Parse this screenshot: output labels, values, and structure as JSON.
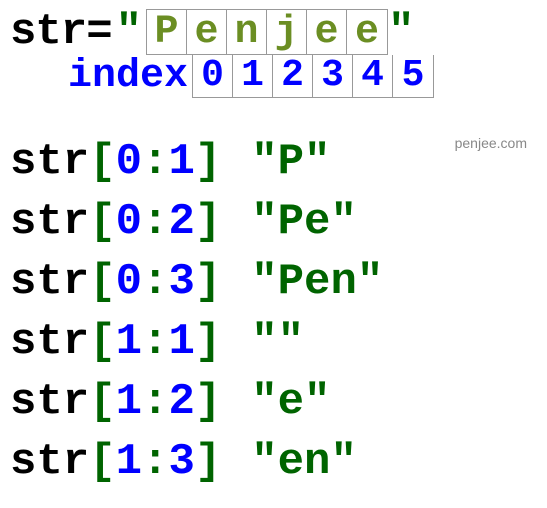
{
  "credit": "penjee.com",
  "header": {
    "var": "str",
    "eq": " = ",
    "open_quote": "\"",
    "close_quote": "\"",
    "chars": [
      "P",
      "e",
      "n",
      "j",
      "e",
      "e"
    ],
    "index_label": "index",
    "indices": [
      "0",
      "1",
      "2",
      "3",
      "4",
      "5"
    ]
  },
  "examples": [
    {
      "var": "str",
      "start": "0",
      "end": "1",
      "result": "\"P\""
    },
    {
      "var": "str",
      "start": "0",
      "end": "2",
      "result": "\"Pe\""
    },
    {
      "var": "str",
      "start": "0",
      "end": "3",
      "result": "\"Pen\""
    },
    {
      "var": "str",
      "start": "1",
      "end": "1",
      "result": "\"\""
    },
    {
      "var": "str",
      "start": "1",
      "end": "2",
      "result": "\"e\""
    },
    {
      "var": "str",
      "start": "1",
      "end": "3",
      "result": "\"en\""
    }
  ]
}
